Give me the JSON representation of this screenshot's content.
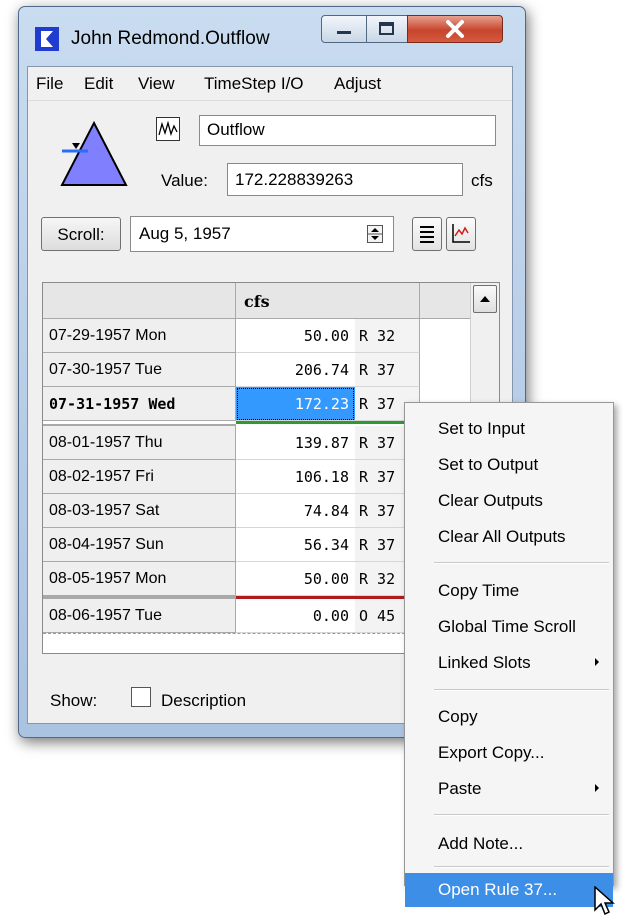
{
  "window": {
    "title": "John Redmond.Outflow",
    "menu": [
      "File",
      "Edit",
      "View",
      "TimeStep I/O",
      "Adjust"
    ],
    "slot_name": "Outflow",
    "value_label": "Value:",
    "value": "172.228839263",
    "units": "cfs",
    "scroll_label": "Scroll:",
    "scroll_date": "Aug 5, 1957",
    "column_header": "cfs",
    "rows": [
      {
        "date": "07-29-1957 Mon",
        "value": "50.00",
        "flag": "R  32"
      },
      {
        "date": "07-30-1957 Tue",
        "value": "206.74",
        "flag": "R  37"
      },
      {
        "date": "07-31-1957 Wed",
        "value": "172.23",
        "flag": "R  37"
      },
      {
        "date": "08-01-1957 Thu",
        "value": "139.87",
        "flag": "R  37"
      },
      {
        "date": "08-02-1957 Fri",
        "value": "106.18",
        "flag": "R  37"
      },
      {
        "date": "08-03-1957 Sat",
        "value": "74.84",
        "flag": "R  37"
      },
      {
        "date": "08-04-1957 Sun",
        "value": "56.34",
        "flag": "R  37"
      },
      {
        "date": "08-05-1957 Mon",
        "value": "50.00",
        "flag": "R  32"
      },
      {
        "date": "08-06-1957 Tue",
        "value": "0.00",
        "flag": "O  45"
      }
    ],
    "show_label": "Show:",
    "description_label": "Description"
  },
  "context_menu": {
    "items": [
      "Set to Input",
      "Set to Output",
      "Clear Outputs",
      "Clear All Outputs",
      "Copy Time",
      "Global Time Scroll",
      "Linked Slots",
      "Copy",
      "Export Copy...",
      "Paste",
      "Add Note...",
      "Open Rule 37..."
    ]
  },
  "colors": {
    "selection": "#3399ff",
    "menu_highlight": "#3d8ee6",
    "triangle": "#8080ff",
    "close_button": "#c6452c"
  },
  "icons": [
    "riverware-app-icon",
    "minimize-icon",
    "maximize-icon",
    "close-icon",
    "slot-plot-icon",
    "spinner-icon",
    "table-view-icon",
    "plot-view-icon",
    "scroll-up-icon",
    "submenu-arrow-icon",
    "mouse-pointer-icon"
  ]
}
